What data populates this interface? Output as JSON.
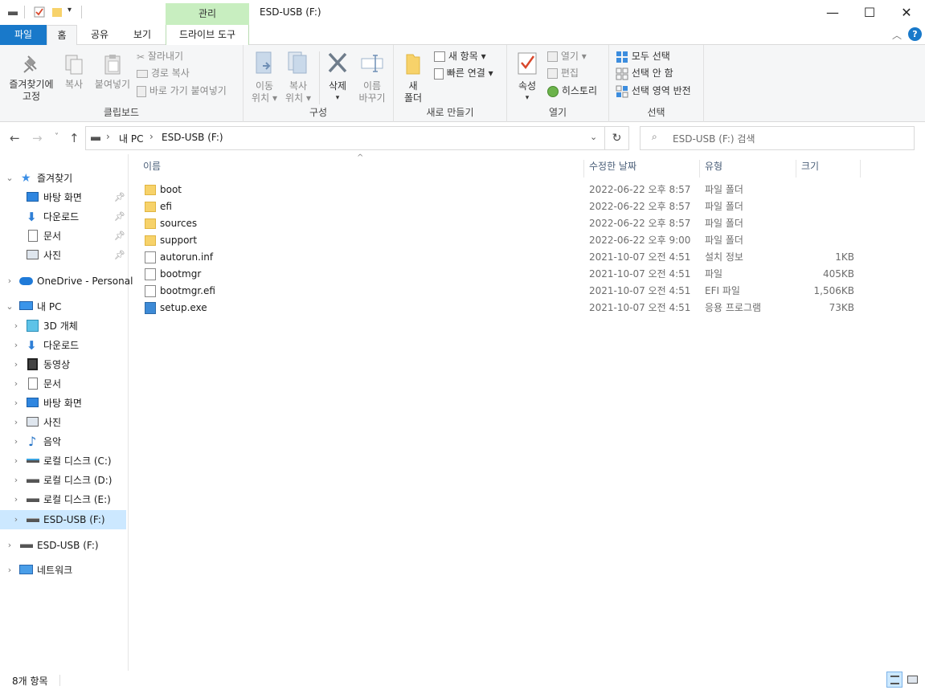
{
  "window": {
    "title": "ESD-USB (F:)",
    "context_tab_header": "관리",
    "controls": {
      "minimize": "—",
      "maximize": "☐",
      "close": "✕"
    }
  },
  "ribbon_tabs": {
    "file": "파일",
    "home": "홈",
    "share": "공유",
    "view": "보기",
    "drive_tools": "드라이브 도구"
  },
  "ribbon": {
    "clipboard": {
      "label": "클립보드",
      "pin_quick_access": [
        "즐겨찾기에",
        "고정"
      ],
      "copy": "복사",
      "paste": "붙여넣기",
      "cut": "잘라내기",
      "copy_path": "경로 복사",
      "paste_shortcut": "바로 가기 붙여넣기"
    },
    "organize": {
      "label": "구성",
      "move_to": [
        "이동",
        "위치"
      ],
      "copy_to": [
        "복사",
        "위치"
      ],
      "delete": "삭제",
      "rename": [
        "이름",
        "바꾸기"
      ]
    },
    "new": {
      "label": "새로 만들기",
      "new_folder": [
        "새",
        "폴더"
      ],
      "new_item": "새 항목",
      "easy_access": "빠른 연결"
    },
    "open": {
      "label": "열기",
      "properties": "속성",
      "open": "열기",
      "edit": "편집",
      "history": "히스토리"
    },
    "select": {
      "label": "선택",
      "select_all": "모두 선택",
      "select_none": "선택 안 함",
      "invert": "선택 영역 반전"
    }
  },
  "address": {
    "path": [
      "내 PC",
      "ESD-USB (F:)"
    ],
    "search_placeholder": "ESD-USB (F:) 검색"
  },
  "nav_pane": {
    "quick_access": "즐겨찾기",
    "quick_items": [
      "바탕 화면",
      "다운로드",
      "문서",
      "사진"
    ],
    "onedrive": "OneDrive - Personal",
    "this_pc": "내 PC",
    "pc_items": [
      "3D 개체",
      "다운로드",
      "동영상",
      "문서",
      "바탕 화면",
      "사진",
      "음악",
      "로컬 디스크 (C:)",
      "로컬 디스크 (D:)",
      "로컬 디스크 (E:)",
      "ESD-USB (F:)"
    ],
    "usb": "ESD-USB (F:)",
    "network": "네트워크"
  },
  "columns": {
    "name": "이름",
    "modified": "수정한 날짜",
    "type": "유형",
    "size": "크기"
  },
  "files": [
    {
      "name": "boot",
      "modified": "2022-06-22 오후 8:57",
      "type": "파일 폴더",
      "size": "",
      "kind": "folder"
    },
    {
      "name": "efi",
      "modified": "2022-06-22 오후 8:57",
      "type": "파일 폴더",
      "size": "",
      "kind": "folder"
    },
    {
      "name": "sources",
      "modified": "2022-06-22 오후 8:57",
      "type": "파일 폴더",
      "size": "",
      "kind": "folder"
    },
    {
      "name": "support",
      "modified": "2022-06-22 오후 9:00",
      "type": "파일 폴더",
      "size": "",
      "kind": "folder"
    },
    {
      "name": "autorun.inf",
      "modified": "2021-10-07 오전 4:51",
      "type": "설치 정보",
      "size": "1KB",
      "kind": "inf"
    },
    {
      "name": "bootmgr",
      "modified": "2021-10-07 오전 4:51",
      "type": "파일",
      "size": "405KB",
      "kind": "file"
    },
    {
      "name": "bootmgr.efi",
      "modified": "2021-10-07 오전 4:51",
      "type": "EFI 파일",
      "size": "1,506KB",
      "kind": "file"
    },
    {
      "name": "setup.exe",
      "modified": "2021-10-07 오전 4:51",
      "type": "응용 프로그램",
      "size": "73KB",
      "kind": "exe"
    }
  ],
  "status": {
    "count": "8개 항목"
  },
  "colors": {
    "file_tab": "#1979ca",
    "context_tab": "#c8eec0",
    "selected": "#cce8ff",
    "folder": "#f7d26a",
    "header_text": "#4c607a"
  }
}
